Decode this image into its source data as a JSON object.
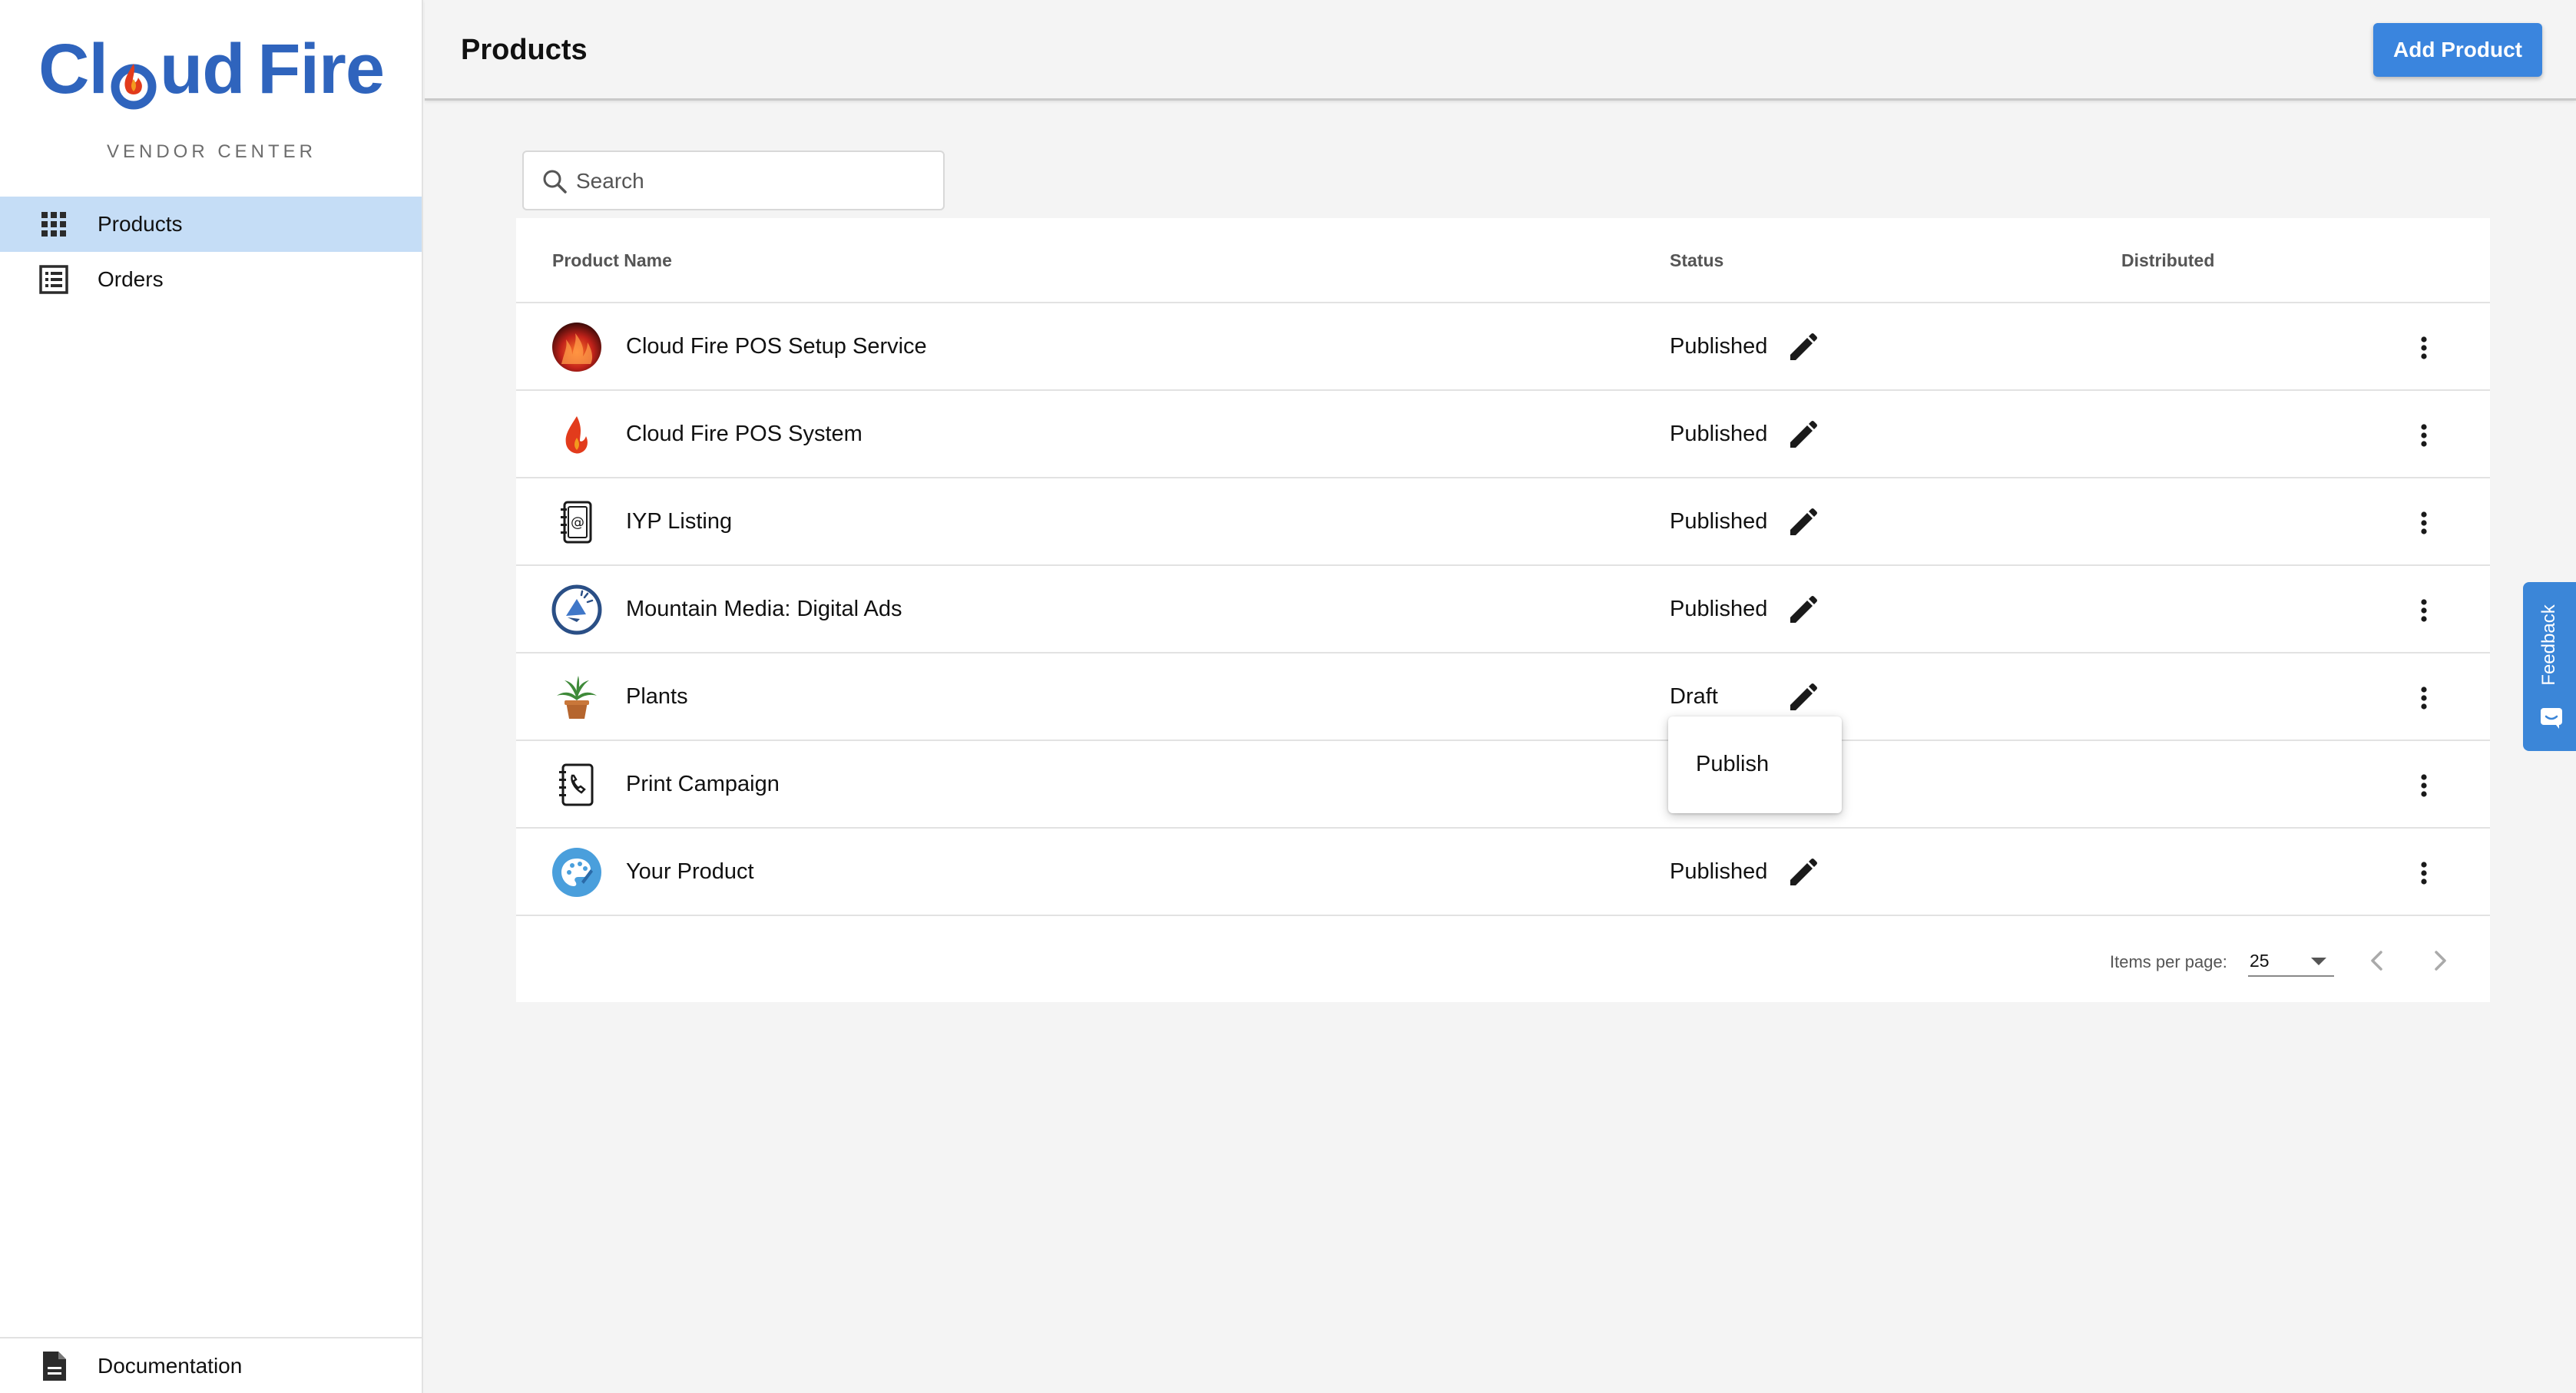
{
  "sidebar": {
    "logo_text_left": "Cl",
    "logo_text_mid": "ud",
    "logo_text_right": "Fire",
    "subtitle": "VENDOR CENTER",
    "items": [
      {
        "label": "Products",
        "icon": "grid-icon",
        "active": true
      },
      {
        "label": "Orders",
        "icon": "list-icon",
        "active": false
      }
    ],
    "footer_item": {
      "label": "Documentation",
      "icon": "document-icon"
    }
  },
  "header": {
    "title": "Products",
    "add_button_label": "Add Product"
  },
  "search": {
    "placeholder": "Search",
    "value": ""
  },
  "table": {
    "columns": [
      "Product Name",
      "Status",
      "Distributed"
    ],
    "rows": [
      {
        "name": "Cloud Fire POS Setup Service",
        "status": "Published",
        "thumb": "fire-photo-thumbnail"
      },
      {
        "name": "Cloud Fire POS System",
        "status": "Published",
        "thumb": "flame-logo-thumbnail"
      },
      {
        "name": "IYP Listing",
        "status": "Published",
        "thumb": "address-book-thumbnail"
      },
      {
        "name": "Mountain Media: Digital Ads",
        "status": "Published",
        "thumb": "megaphone-thumbnail"
      },
      {
        "name": "Plants",
        "status": "Draft",
        "thumb": "potted-plant-thumbnail"
      },
      {
        "name": "Print Campaign",
        "status": "",
        "thumb": "phone-book-thumbnail"
      },
      {
        "name": "Your Product",
        "status": "Published",
        "thumb": "palette-thumbnail"
      }
    ],
    "status_menu": {
      "options": [
        "Publish"
      ]
    },
    "pagination": {
      "items_per_page_label": "Items per page:",
      "items_per_page_value": "25"
    }
  },
  "feedback": {
    "label": "Feedback"
  },
  "colors": {
    "brand_blue": "#2f64bd",
    "accent_blue": "#3a85de",
    "active_nav": "#c5ddf6",
    "flame_red": "#e23b1c",
    "flame_orange": "#f39a1e"
  }
}
